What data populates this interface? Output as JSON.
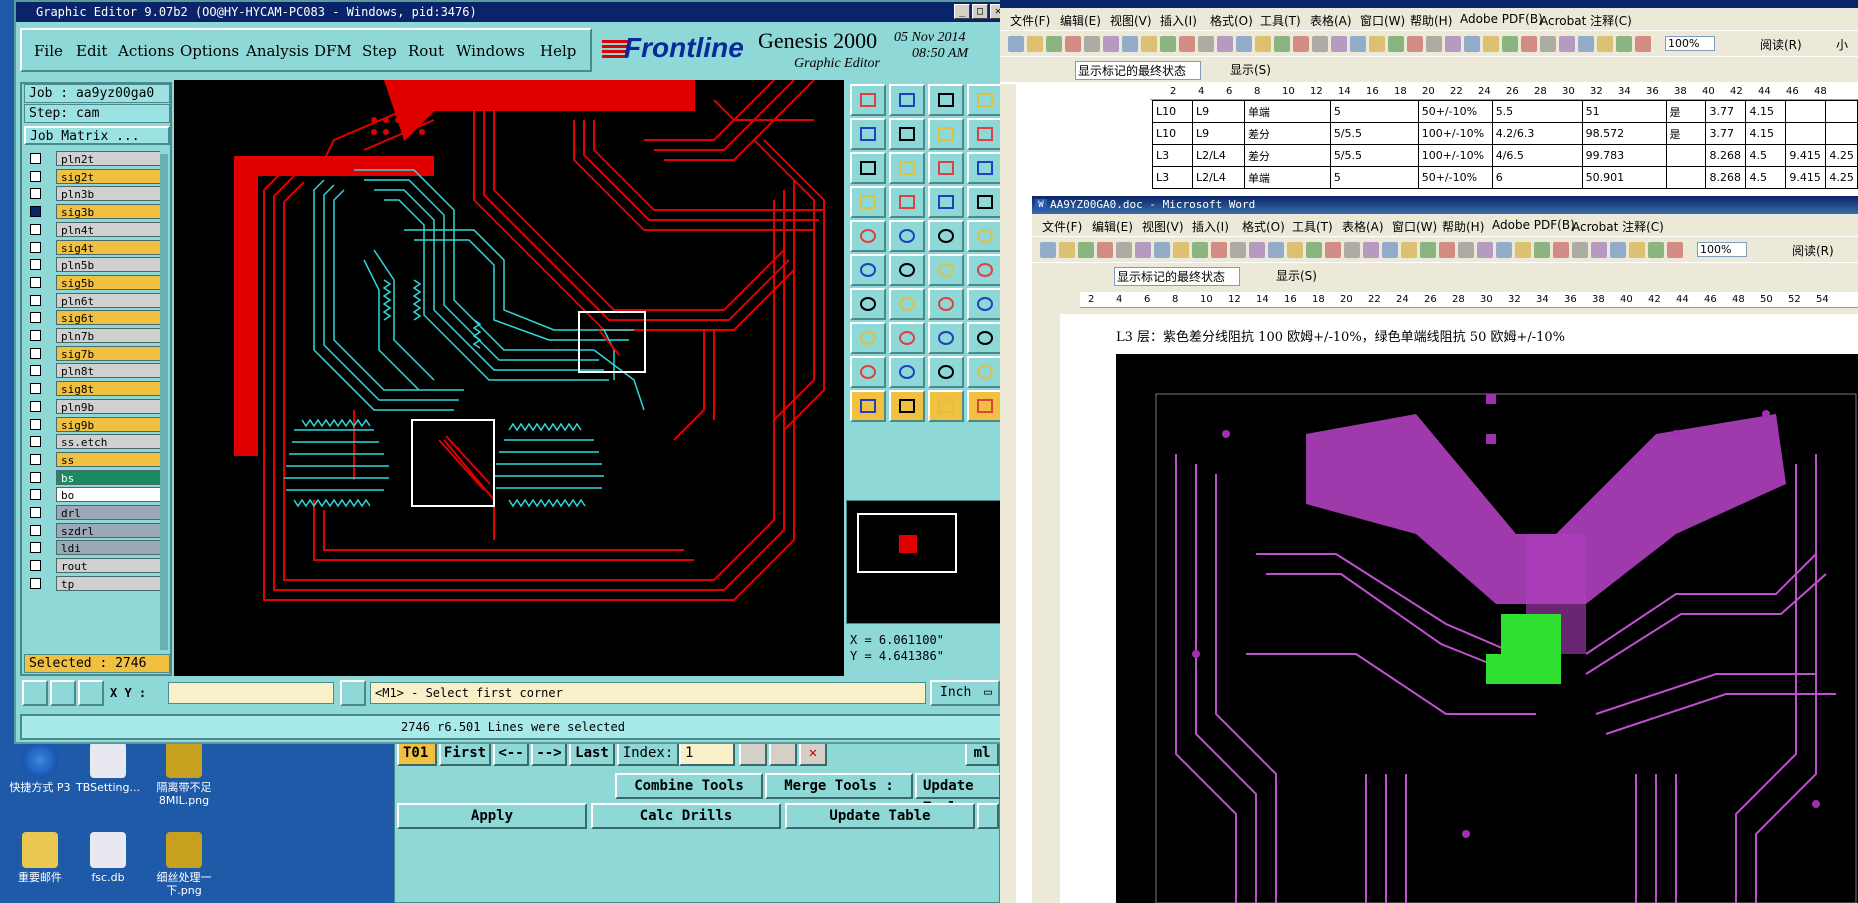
{
  "desktop": {
    "icons": [
      {
        "label": "快捷方式 P3"
      },
      {
        "label": "TBSetting..."
      },
      {
        "label": "隔离带不足\n8MIL.png"
      },
      {
        "label": "重要邮件"
      },
      {
        "label": "fsc.db"
      },
      {
        "label": "细丝处理一\n下.png"
      }
    ]
  },
  "genesis": {
    "title": "Graphic Editor 9.07b2 (OO@HY-HYCAM-PC083 - Windows, pid:3476)",
    "menu": [
      "File",
      "Edit",
      "Actions",
      "Options",
      "Analysis",
      "DFM",
      "Step",
      "Rout",
      "Windows",
      "Help"
    ],
    "brand": "Frontline",
    "product": "Genesis 2000",
    "subtitle": "Graphic Editor",
    "date": "05 Nov 2014",
    "time": "08:50 AM",
    "job": "Job : aa9yz00ga0",
    "step": "Step: cam",
    "job_matrix": "Job Matrix ...",
    "layers": [
      {
        "name": "pln2t",
        "color": "#d0d0d0"
      },
      {
        "name": "sig2t",
        "color": "#f0c040"
      },
      {
        "name": "pln3b",
        "color": "#d0d0d0"
      },
      {
        "name": "sig3b",
        "color": "#f0c040"
      },
      {
        "name": "pln4t",
        "color": "#d0d0d0"
      },
      {
        "name": "sig4t",
        "color": "#f0c040"
      },
      {
        "name": "pln5b",
        "color": "#d0d0d0"
      },
      {
        "name": "sig5b",
        "color": "#f0c040"
      },
      {
        "name": "pln6t",
        "color": "#d0d0d0"
      },
      {
        "name": "sig6t",
        "color": "#f0c040"
      },
      {
        "name": "pln7b",
        "color": "#d0d0d0"
      },
      {
        "name": "sig7b",
        "color": "#f0c040"
      },
      {
        "name": "pln8t",
        "color": "#d0d0d0"
      },
      {
        "name": "sig8t",
        "color": "#f0c040"
      },
      {
        "name": "pln9b",
        "color": "#d0d0d0"
      },
      {
        "name": "sig9b",
        "color": "#f0c040"
      },
      {
        "name": "ss.etch",
        "color": "#d0d0d0"
      },
      {
        "name": "ss",
        "color": "#f0c040"
      },
      {
        "name": "bs",
        "color": "#1a8a60"
      },
      {
        "name": "bo",
        "color": "#ffffff"
      },
      {
        "name": "drl",
        "color": "#9aa8b8"
      },
      {
        "name": "szdrl",
        "color": "#9aa8b8"
      },
      {
        "name": "ldi",
        "color": "#9aa8b8"
      },
      {
        "name": "rout",
        "color": "#d0d0d0"
      },
      {
        "name": "tp",
        "color": "#d0d0d0"
      }
    ],
    "selected": "Selected : 2746",
    "coord_x": "X = 6.061100\"",
    "coord_y": "Y = 4.641386\"",
    "xy_label": "X Y :",
    "xy_value": "",
    "prompt": "<M1> - Select first corner",
    "units": "Inch",
    "status": "2746 r6.501 Lines were selected"
  },
  "drill": {
    "tool": "T01",
    "nav": [
      "First",
      "<--",
      "-->",
      "Last"
    ],
    "index_label": "Index:",
    "index_value": "1",
    "right_label": "ml",
    "combine": "Combine Tools",
    "merge": "Merge Tools :",
    "update_tools": "Update Tool",
    "apply": "Apply",
    "calc": "Calc Drills",
    "update_table": "Update Table"
  },
  "word_back": {
    "menu": [
      "文件(F)",
      "编辑(E)",
      "视图(V)",
      "插入(I)",
      "格式(O)",
      "工具(T)",
      "表格(A)",
      "窗口(W)",
      "帮助(H)",
      "Adobe PDF(B)",
      "Acrobat 注释(C)"
    ],
    "zoom": "100%",
    "read": "阅读(R)",
    "extra": "小组",
    "track": "显示标记的最终状态",
    "show": "显示(S)",
    "ruler": [
      "2",
      "4",
      "6",
      "8",
      "10",
      "12",
      "14",
      "16",
      "18",
      "20",
      "22",
      "24",
      "26",
      "28",
      "30",
      "32",
      "34",
      "36",
      "38",
      "40",
      "42",
      "44",
      "46",
      "48"
    ],
    "rows": [
      [
        "L10",
        "L9",
        "单端",
        "5",
        "50+/-10%",
        "5.5",
        "51",
        "是",
        "3.77",
        "4.15",
        ""
      ],
      [
        "L10",
        "L9",
        "差分",
        "5/5.5",
        "100+/-10%",
        "4.2/6.3",
        "98.572",
        "是",
        "3.77",
        "4.15",
        ""
      ],
      [
        "L3",
        "L2/L4",
        "差分",
        "5/5.5",
        "100+/-10%",
        "4/6.5",
        "99.783",
        "",
        "8.268",
        "4.5",
        "9.415",
        "4.25"
      ],
      [
        "L3",
        "L2/L4",
        "单端",
        "5",
        "50+/-10%",
        "6",
        "50.901",
        "",
        "8.268",
        "4.5",
        "9.415",
        "4.25"
      ]
    ]
  },
  "word_front": {
    "title": "AA9YZ00GA0.doc - Microsoft Word",
    "menu": [
      "文件(F)",
      "编辑(E)",
      "视图(V)",
      "插入(I)",
      "格式(O)",
      "工具(T)",
      "表格(A)",
      "窗口(W)",
      "帮助(H)",
      "Adobe PDF(B)",
      "Acrobat 注释(C)"
    ],
    "zoom": "100%",
    "read": "阅读(R)",
    "track": "显示标记的最终状态",
    "show": "显示(S)",
    "ruler": [
      "2",
      "4",
      "6",
      "8",
      "10",
      "12",
      "14",
      "16",
      "18",
      "20",
      "22",
      "24",
      "26",
      "28",
      "30",
      "32",
      "34",
      "36",
      "38",
      "40",
      "42",
      "44",
      "46",
      "48",
      "50",
      "52",
      "54"
    ],
    "note": "L3 层：紫色差分线阻抗 100 欧姆+/-10%，绿色单端线阻抗 50 欧姆+/-10%"
  }
}
